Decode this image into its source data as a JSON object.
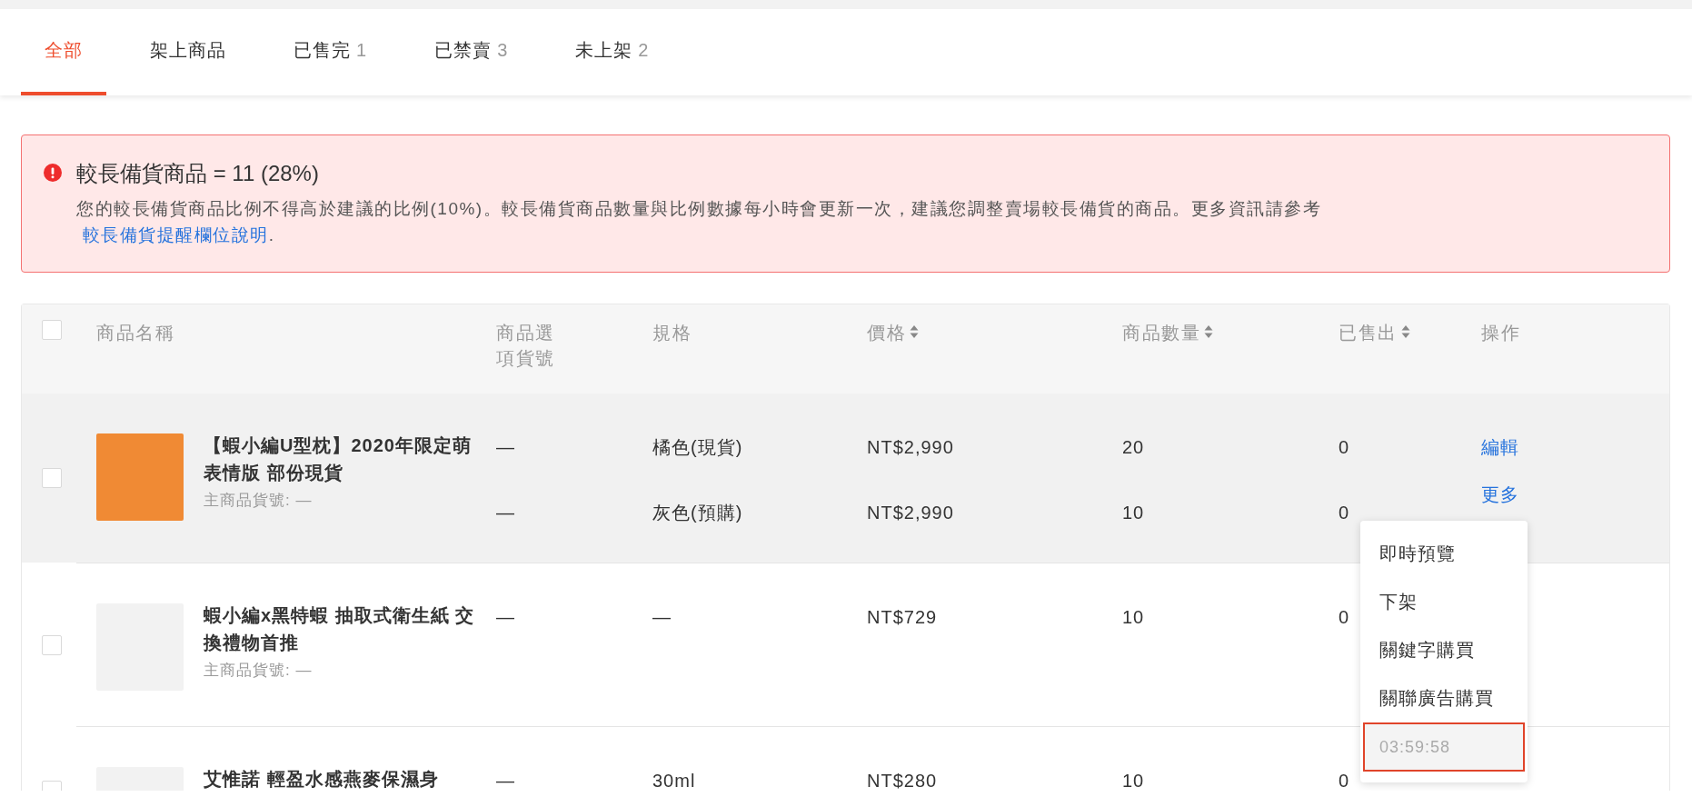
{
  "tabs": [
    {
      "label": "全部",
      "selected": true
    },
    {
      "label": "架上商品",
      "selected": false
    },
    {
      "label": "已售完",
      "count": "1",
      "selected": false
    },
    {
      "label": "已禁賣",
      "count": "3",
      "selected": false
    },
    {
      "label": "未上架",
      "count": "2",
      "selected": false
    }
  ],
  "alert": {
    "title": "較長備貨商品 = 11 (28%)",
    "body": "您的較長備貨商品比例不得高於建議的比例(10%)。較長備貨商品數量與比例數據每小時會更新一次，建議您調整賣場較長備貨的商品。更多資訊請參考",
    "link": "較長備貨提醒欄位說明",
    "body_end": "."
  },
  "table": {
    "select_all": {
      "checked": false
    },
    "columns": [
      {
        "label": "商品名稱",
        "sortable": false
      },
      {
        "label": "商品選項貨號",
        "sortable": false
      },
      {
        "label": "規格",
        "sortable": false
      },
      {
        "label": "價格",
        "sortable": true
      },
      {
        "label": "商品數量",
        "sortable": true
      },
      {
        "label": "已售出",
        "sortable": true
      },
      {
        "label": "操作",
        "sortable": false
      }
    ],
    "rows": [
      {
        "checked": false,
        "hovered": true,
        "name": "【蝦小編U型枕】2020年限定萌表情版 部份現貨",
        "sku": "主商品貨號: —",
        "variants": [
          {
            "option_sku": "—",
            "spec": "橘色(現貨)",
            "price": "NT$2,990",
            "quantity": "20",
            "sold": "0"
          },
          {
            "option_sku": "—",
            "spec": "灰色(預購)",
            "price": "NT$2,990",
            "quantity": "10",
            "sold": "0"
          }
        ],
        "actions": [
          "編輯",
          "更多"
        ],
        "menu": [
          {
            "label": "即時預覽",
            "kind": "item"
          },
          {
            "label": "下架",
            "kind": "item"
          },
          {
            "label": "關鍵字購買",
            "kind": "item"
          },
          {
            "label": "關聯廣告購買",
            "kind": "item"
          },
          {
            "label": "03:59:58",
            "kind": "timer"
          }
        ]
      },
      {
        "checked": false,
        "hovered": false,
        "name": "蝦小編x黑特蝦 抽取式衛生紙 交換禮物首推",
        "sku": "主商品貨號: —",
        "variants": [
          {
            "option_sku": "—",
            "spec": "—",
            "price": "NT$729",
            "quantity": "10",
            "sold": "0"
          }
        ]
      },
      {
        "checked": false,
        "hovered": false,
        "name": "艾惟諾 輕盈水感燕麥保濕身",
        "variants": [
          {
            "option_sku": "—",
            "spec": "30ml",
            "price": "NT$280",
            "quantity": "10",
            "sold": "0"
          }
        ]
      }
    ]
  }
}
